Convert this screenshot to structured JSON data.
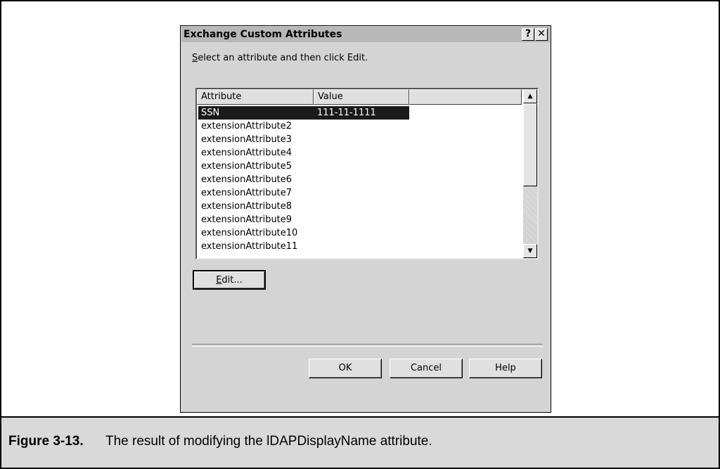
{
  "dialog": {
    "title": "Exchange Custom Attributes",
    "help_glyph": "?",
    "close_glyph": "✕",
    "prompt_accel": "S",
    "prompt_rest": "elect an attribute and then click Edit."
  },
  "list": {
    "columns": [
      "Attribute",
      "Value"
    ],
    "rows": [
      {
        "attribute": "SSN",
        "value": "111-11-1111",
        "selected": true
      },
      {
        "attribute": "extensionAttribute2",
        "value": ""
      },
      {
        "attribute": "extensionAttribute3",
        "value": ""
      },
      {
        "attribute": "extensionAttribute4",
        "value": ""
      },
      {
        "attribute": "extensionAttribute5",
        "value": ""
      },
      {
        "attribute": "extensionAttribute6",
        "value": ""
      },
      {
        "attribute": "extensionAttribute7",
        "value": ""
      },
      {
        "attribute": "extensionAttribute8",
        "value": ""
      },
      {
        "attribute": "extensionAttribute9",
        "value": ""
      },
      {
        "attribute": "extensionAttribute10",
        "value": ""
      },
      {
        "attribute": "extensionAttribute11",
        "value": ""
      }
    ],
    "scroll_up_glyph": "▲",
    "scroll_down_glyph": "▼"
  },
  "buttons": {
    "edit_accel": "E",
    "edit_rest": "dit...",
    "ok": "OK",
    "cancel": "Cancel",
    "help": "Help"
  },
  "caption": {
    "number": "Figure 3-13.",
    "text": "The result of modifying the lDAPDisplayName attribute."
  }
}
